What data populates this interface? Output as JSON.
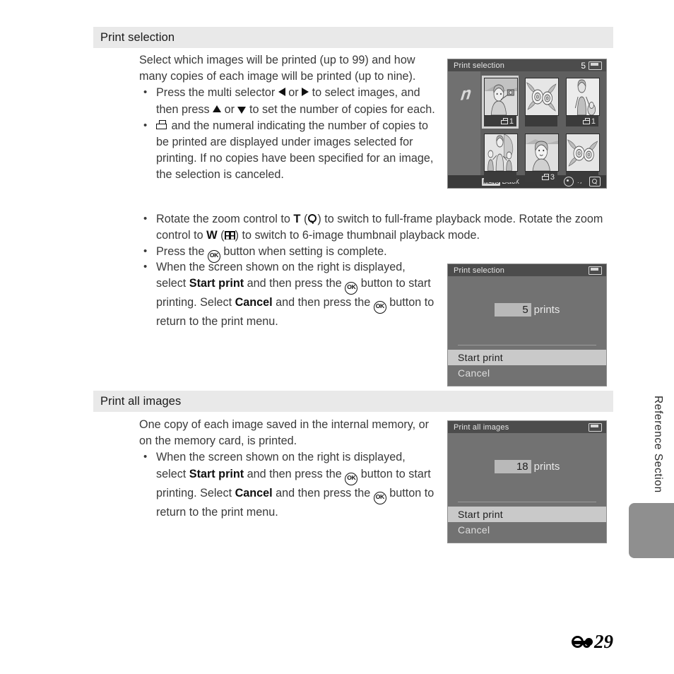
{
  "sections": [
    {
      "heading": "Print selection",
      "intro": "Select which images will be printed (up to 99) and how many copies of each image will be printed (up to nine).",
      "bullets": [
        "Press the multi selector ◀ or ▶ to select images, and then press ▲ or ▼ to set the number of copies for each.",
        "🖶 and the numeral indicating the number of copies to be printed are displayed under images selected for printing. If no copies have been specified for an image, the selection is canceled.",
        "Rotate the zoom control to T (🔍) to switch to full-frame playback mode. Rotate the zoom control to W (▦) to switch to 6-image thumbnail playback mode.",
        "Press the OK button when setting is complete.",
        "When the screen shown on the right is displayed, select Start print and then press the OK button to start printing. Select Cancel and then press the OK button to return to the print menu."
      ]
    },
    {
      "heading": "Print all images",
      "intro": "One copy of each image saved in the internal memory, or on the memory card, is printed.",
      "bullets": [
        "When the screen shown on the right is displayed, select Start print and then press the OK button to start printing. Select Cancel and then press the OK button to return to the print menu."
      ]
    }
  ],
  "text_fragments": {
    "press_multi_1": "Press the multi selector ",
    "or": " or ",
    "to_select_images": " to select images, and then press ",
    "to_set_copies": " to set the number of copies for each.",
    "printer_numeral": " and the numeral indicating the number of copies to be printed are displayed under images selected for printing. If no copies have been specified for an image, the selection is canceled.",
    "rotate_zoom_a": "Rotate the zoom control to ",
    "zoom_t": "T",
    "paren_open": " (",
    "paren_close": ") ",
    "rotate_zoom_b": "to switch to full-frame playback mode. Rotate the zoom control to ",
    "zoom_w": "W",
    "rotate_zoom_c": "to switch to 6-image thumbnail playback mode.",
    "press_ok_a": "Press the ",
    "press_ok_b": " button when setting is complete.",
    "when_screen": "When the screen shown on the right is displayed, select ",
    "start_print_bold": "Start print",
    "and_then_press": " and then press the ",
    "button_to_start": " button to start printing. Select ",
    "cancel_bold": "Cancel",
    "and_then_press2": " and then press the ",
    "button_return": " button to return to the print menu."
  },
  "screens": {
    "print_selection_grid": {
      "title": "Print selection",
      "count": "5",
      "battery_icon": "battery-full-icon",
      "left_icon": "leaf-icon",
      "thumbnails": [
        {
          "name": "portrait-with-camera",
          "copies": "1",
          "selected": true
        },
        {
          "name": "flowers-close-up",
          "copies": "",
          "selected": false
        },
        {
          "name": "woman-standing",
          "copies": "1",
          "selected": false
        },
        {
          "name": "mother-and-children",
          "copies": "",
          "selected": false
        },
        {
          "name": "portrait-smiling",
          "copies": "3",
          "selected": false
        },
        {
          "name": "roses-bouquet",
          "copies": "",
          "selected": false
        }
      ],
      "bottom_back_badge": "MENU",
      "bottom_back_label": "Back",
      "bottom_plusminus": "+/−",
      "bottom_icons": [
        "multi-selector-icon",
        "magnifier-icon"
      ]
    },
    "print_selection_dialog": {
      "title": "Print selection",
      "battery_icon": "battery-full-icon",
      "count_value": "5",
      "count_unit": "prints",
      "menu": [
        {
          "label": "Start print",
          "highlighted": true
        },
        {
          "label": "Cancel",
          "highlighted": false
        }
      ]
    },
    "print_all_dialog": {
      "title": "Print all images",
      "battery_icon": "battery-full-icon",
      "count_value": "18",
      "count_unit": "prints",
      "menu": [
        {
          "label": "Start print",
          "highlighted": true
        },
        {
          "label": "Cancel",
          "highlighted": false
        }
      ]
    }
  },
  "side_tab": {
    "label": "Reference Section"
  },
  "footer": {
    "section_glyph": "E",
    "page_number": "29"
  },
  "colors": {
    "header_bg": "#e9e9e9",
    "body_text": "#3a3a3a",
    "screen_bg": "#6f6f6f",
    "screen_title_bg": "#4c4c4c",
    "highlight": "#c9c9c9",
    "tab_gray": "#8f8f8f"
  }
}
